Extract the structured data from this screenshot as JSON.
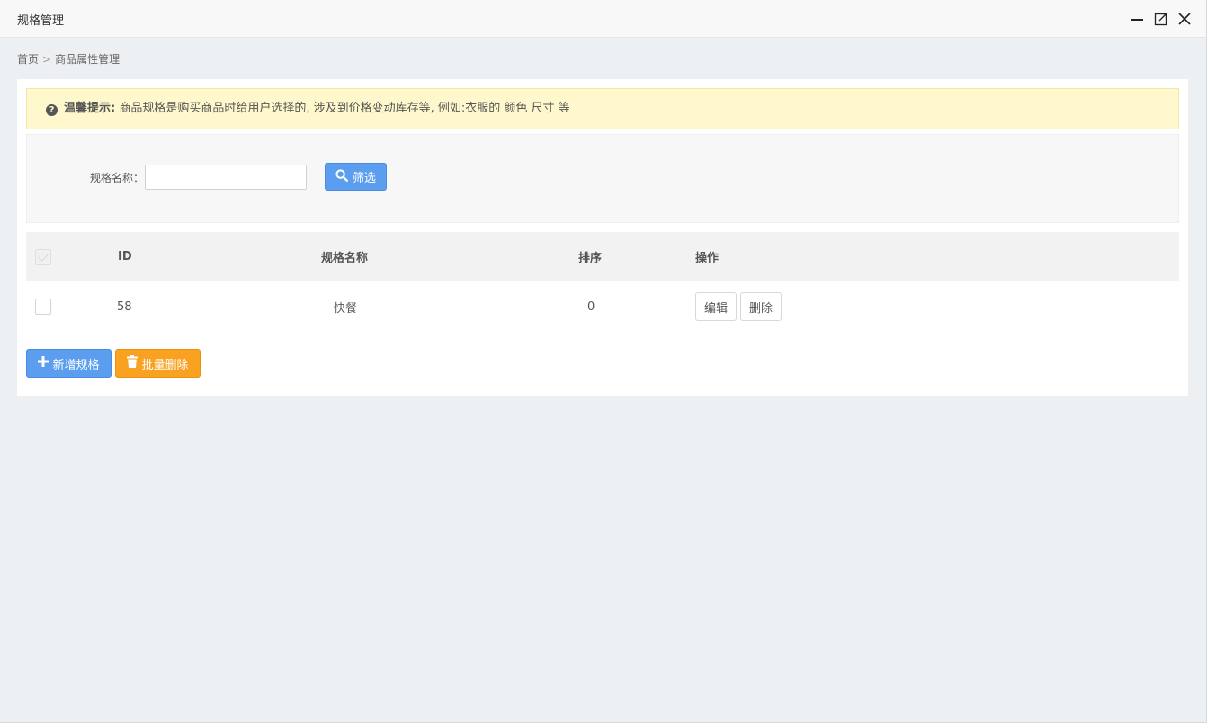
{
  "window": {
    "title": "规格管理",
    "controls": [
      "minimize-icon",
      "maximize-icon",
      "close-icon"
    ]
  },
  "breadcrumb": {
    "home": "首页",
    "separator": ">",
    "current": "商品属性管理"
  },
  "tip": {
    "icon": "question-circle-icon",
    "label": "温馨提示:",
    "text": "商品规格是购买商品时给用户选择的, 涉及到价格变动库存等, 例如:衣服的 颜色 尺寸 等"
  },
  "filter": {
    "label": "规格名称：",
    "input_value": "",
    "button_label": "筛选",
    "button_icon": "search-icon"
  },
  "table": {
    "columns": [
      "ID",
      "规格名称",
      "排序",
      "操作"
    ],
    "rows": [
      {
        "id": "58",
        "name": "快餐",
        "sort": "0",
        "edit": "编辑",
        "delete": "删除"
      }
    ]
  },
  "actions": {
    "add_label": "新增规格",
    "add_icon": "plus-icon",
    "batch_delete_label": "批量删除",
    "batch_delete_icon": "trash-icon"
  },
  "colors": {
    "primary": "#5b9ef0",
    "warning": "#f9a221",
    "tip_background": "#fff8cc",
    "page_background": "#edf0f3"
  }
}
